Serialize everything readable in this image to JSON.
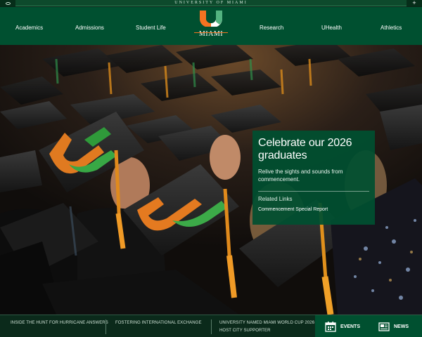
{
  "utility_bar": {
    "university_name": "UNIVERSITY OF MIAMI",
    "expand_symbol": "+"
  },
  "nav": {
    "items_left": [
      "Academics",
      "Admissions",
      "Student Life"
    ],
    "logo_wordmark": "MIAMI",
    "items_right": [
      "Research",
      "UHealth",
      "Athletics"
    ]
  },
  "hero": {
    "title": "Celebrate our 2026 graduates",
    "subtitle": "Relive the sights and sounds from commencement.",
    "related_heading": "Related Links",
    "related_link": "Commencement Special Report"
  },
  "bottom": {
    "stories": [
      "INSIDE THE HUNT FOR HURRICANE ANSWERS",
      "FOSTERING INTERNATIONAL EXCHANGE",
      "UNIVERSITY NAMED MIAMI WORLD CUP 2026 HOST CITY SUPPORTER"
    ],
    "events_label": "EVENTS",
    "news_label": "NEWS"
  },
  "colors": {
    "brand_green": "#005030",
    "brand_orange": "#f47321"
  }
}
